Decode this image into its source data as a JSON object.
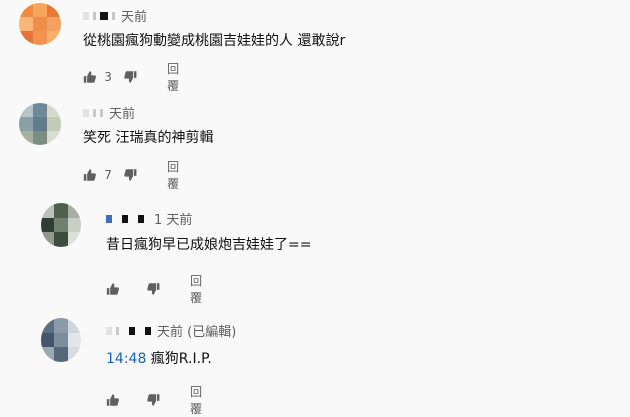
{
  "comments": [
    {
      "time": "天前",
      "text": "從桃園瘋狗動變成桃園吉娃娃的人 還敢說r",
      "likes": "3",
      "reply_label": "回覆",
      "avatar_colors": [
        "#f08a3c",
        "#f5a65a",
        "#e9773a",
        "#f8b778",
        "#ee8d4a",
        "#f4a060",
        "#e6743c",
        "#f29250",
        "#f7b06c"
      ]
    },
    {
      "time": "天前",
      "text": "笑死 汪瑞真的神剪輯",
      "likes": "7",
      "reply_label": "回覆",
      "avatar_colors": [
        "#b8c3c7",
        "#6e8a9a",
        "#d6d9cc",
        "#8aa0a6",
        "#5f7d8c",
        "#c4cab8",
        "#a6b0a0",
        "#7a8f80",
        "#d8dcd2"
      ]
    },
    {
      "time": "1 天前",
      "text": "昔日瘋狗早已成娘炮吉娃娃了==",
      "likes": "",
      "reply_label": "回覆",
      "avatar_colors": [
        "#b9c2b8",
        "#4f6050",
        "#a8b0a4",
        "#2f3d34",
        "#6f7f70",
        "#c9cfc4",
        "#8e9a8a",
        "#3e4c40",
        "#dde0d8"
      ]
    },
    {
      "time": "天前 (已編輯)",
      "timestamp": "14:48",
      "text": " 瘋狗R.I.P.",
      "likes": "",
      "reply_label": "回覆",
      "avatar_colors": [
        "#5d6f80",
        "#8a9aa8",
        "#cfd6dc",
        "#44566a",
        "#7c8d9c",
        "#e2e6ea",
        "#9aa8b4",
        "#566878",
        "#d8dde2"
      ]
    }
  ]
}
